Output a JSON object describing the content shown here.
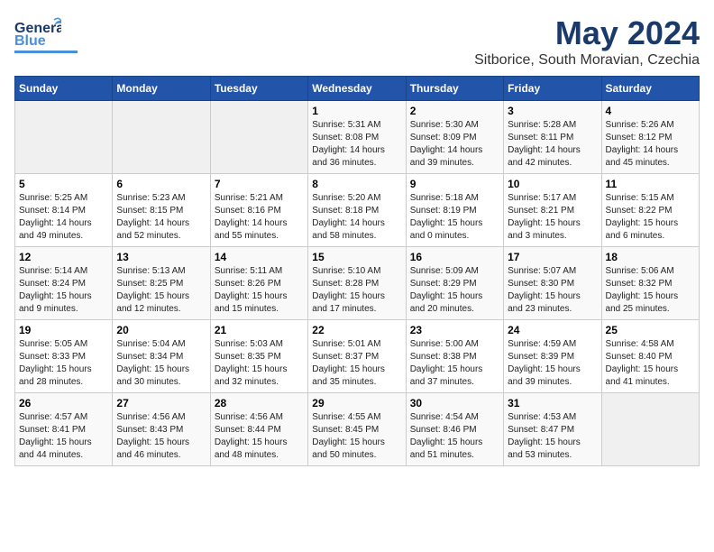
{
  "header": {
    "logo_line1": "General",
    "logo_line2": "Blue",
    "month": "May 2024",
    "location": "Sitborice, South Moravian, Czechia"
  },
  "weekdays": [
    "Sunday",
    "Monday",
    "Tuesday",
    "Wednesday",
    "Thursday",
    "Friday",
    "Saturday"
  ],
  "weeks": [
    [
      {
        "num": "",
        "info": ""
      },
      {
        "num": "",
        "info": ""
      },
      {
        "num": "",
        "info": ""
      },
      {
        "num": "1",
        "info": "Sunrise: 5:31 AM\nSunset: 8:08 PM\nDaylight: 14 hours\nand 36 minutes."
      },
      {
        "num": "2",
        "info": "Sunrise: 5:30 AM\nSunset: 8:09 PM\nDaylight: 14 hours\nand 39 minutes."
      },
      {
        "num": "3",
        "info": "Sunrise: 5:28 AM\nSunset: 8:11 PM\nDaylight: 14 hours\nand 42 minutes."
      },
      {
        "num": "4",
        "info": "Sunrise: 5:26 AM\nSunset: 8:12 PM\nDaylight: 14 hours\nand 45 minutes."
      }
    ],
    [
      {
        "num": "5",
        "info": "Sunrise: 5:25 AM\nSunset: 8:14 PM\nDaylight: 14 hours\nand 49 minutes."
      },
      {
        "num": "6",
        "info": "Sunrise: 5:23 AM\nSunset: 8:15 PM\nDaylight: 14 hours\nand 52 minutes."
      },
      {
        "num": "7",
        "info": "Sunrise: 5:21 AM\nSunset: 8:16 PM\nDaylight: 14 hours\nand 55 minutes."
      },
      {
        "num": "8",
        "info": "Sunrise: 5:20 AM\nSunset: 8:18 PM\nDaylight: 14 hours\nand 58 minutes."
      },
      {
        "num": "9",
        "info": "Sunrise: 5:18 AM\nSunset: 8:19 PM\nDaylight: 15 hours\nand 0 minutes."
      },
      {
        "num": "10",
        "info": "Sunrise: 5:17 AM\nSunset: 8:21 PM\nDaylight: 15 hours\nand 3 minutes."
      },
      {
        "num": "11",
        "info": "Sunrise: 5:15 AM\nSunset: 8:22 PM\nDaylight: 15 hours\nand 6 minutes."
      }
    ],
    [
      {
        "num": "12",
        "info": "Sunrise: 5:14 AM\nSunset: 8:24 PM\nDaylight: 15 hours\nand 9 minutes."
      },
      {
        "num": "13",
        "info": "Sunrise: 5:13 AM\nSunset: 8:25 PM\nDaylight: 15 hours\nand 12 minutes."
      },
      {
        "num": "14",
        "info": "Sunrise: 5:11 AM\nSunset: 8:26 PM\nDaylight: 15 hours\nand 15 minutes."
      },
      {
        "num": "15",
        "info": "Sunrise: 5:10 AM\nSunset: 8:28 PM\nDaylight: 15 hours\nand 17 minutes."
      },
      {
        "num": "16",
        "info": "Sunrise: 5:09 AM\nSunset: 8:29 PM\nDaylight: 15 hours\nand 20 minutes."
      },
      {
        "num": "17",
        "info": "Sunrise: 5:07 AM\nSunset: 8:30 PM\nDaylight: 15 hours\nand 23 minutes."
      },
      {
        "num": "18",
        "info": "Sunrise: 5:06 AM\nSunset: 8:32 PM\nDaylight: 15 hours\nand 25 minutes."
      }
    ],
    [
      {
        "num": "19",
        "info": "Sunrise: 5:05 AM\nSunset: 8:33 PM\nDaylight: 15 hours\nand 28 minutes."
      },
      {
        "num": "20",
        "info": "Sunrise: 5:04 AM\nSunset: 8:34 PM\nDaylight: 15 hours\nand 30 minutes."
      },
      {
        "num": "21",
        "info": "Sunrise: 5:03 AM\nSunset: 8:35 PM\nDaylight: 15 hours\nand 32 minutes."
      },
      {
        "num": "22",
        "info": "Sunrise: 5:01 AM\nSunset: 8:37 PM\nDaylight: 15 hours\nand 35 minutes."
      },
      {
        "num": "23",
        "info": "Sunrise: 5:00 AM\nSunset: 8:38 PM\nDaylight: 15 hours\nand 37 minutes."
      },
      {
        "num": "24",
        "info": "Sunrise: 4:59 AM\nSunset: 8:39 PM\nDaylight: 15 hours\nand 39 minutes."
      },
      {
        "num": "25",
        "info": "Sunrise: 4:58 AM\nSunset: 8:40 PM\nDaylight: 15 hours\nand 41 minutes."
      }
    ],
    [
      {
        "num": "26",
        "info": "Sunrise: 4:57 AM\nSunset: 8:41 PM\nDaylight: 15 hours\nand 44 minutes."
      },
      {
        "num": "27",
        "info": "Sunrise: 4:56 AM\nSunset: 8:43 PM\nDaylight: 15 hours\nand 46 minutes."
      },
      {
        "num": "28",
        "info": "Sunrise: 4:56 AM\nSunset: 8:44 PM\nDaylight: 15 hours\nand 48 minutes."
      },
      {
        "num": "29",
        "info": "Sunrise: 4:55 AM\nSunset: 8:45 PM\nDaylight: 15 hours\nand 50 minutes."
      },
      {
        "num": "30",
        "info": "Sunrise: 4:54 AM\nSunset: 8:46 PM\nDaylight: 15 hours\nand 51 minutes."
      },
      {
        "num": "31",
        "info": "Sunrise: 4:53 AM\nSunset: 8:47 PM\nDaylight: 15 hours\nand 53 minutes."
      },
      {
        "num": "",
        "info": ""
      }
    ]
  ]
}
